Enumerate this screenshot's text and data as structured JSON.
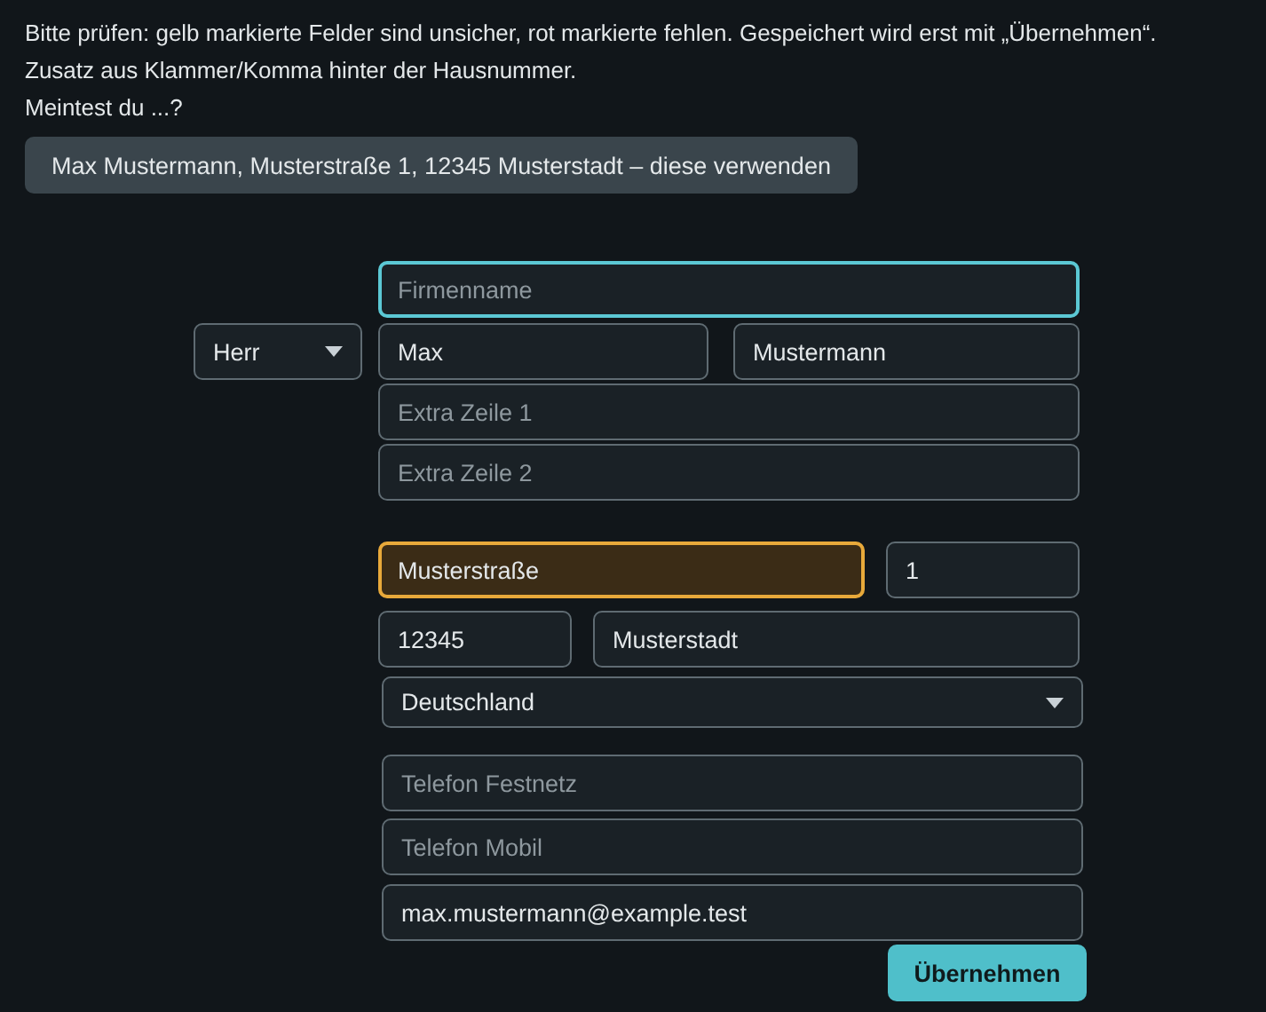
{
  "notice": {
    "lines": [
      "Bitte prüfen: gelb markierte Felder sind unsicher, rot markierte fehlen. Gespeichert wird erst mit „Übernehmen“.",
      "Zusatz aus Klammer/Komma hinter der Hausnummer.",
      "Meintest du ...?"
    ]
  },
  "suggestion_button": "Max Mustermann, Musterstraße 1, 12345 Musterstadt – diese verwenden",
  "form": {
    "company": {
      "placeholder": "Firmenname",
      "focused": true,
      "uncertain": false
    },
    "salutation": {
      "value": "Herr"
    },
    "first_name": {
      "value": "Max",
      "focused": false,
      "uncertain": false
    },
    "last_name": {
      "value": "Mustermann",
      "focused": false,
      "uncertain": false
    },
    "extra_lines": [
      {
        "placeholder": "Extra Zeile 1",
        "focused": false,
        "uncertain": false
      },
      {
        "placeholder": "Extra Zeile 2",
        "focused": false,
        "uncertain": false
      }
    ],
    "street": {
      "value": "Musterstraße",
      "focused": false,
      "uncertain": true
    },
    "house_number": {
      "value": "1",
      "focused": false,
      "uncertain": false
    },
    "postal_code": {
      "value": "12345",
      "focused": false,
      "uncertain": false
    },
    "city": {
      "value": "Musterstadt",
      "focused": false,
      "uncertain": false
    },
    "country": {
      "value": "Deutschland"
    },
    "phone_landline": {
      "placeholder": "Telefon Festnetz",
      "focused": false,
      "uncertain": false
    },
    "phone_mobile": {
      "placeholder": "Telefon Mobil",
      "focused": false,
      "uncertain": false
    },
    "email": {
      "value": "max.mustermann@example.test",
      "focused": false,
      "uncertain": false
    }
  },
  "submit_button": "Übernehmen"
}
